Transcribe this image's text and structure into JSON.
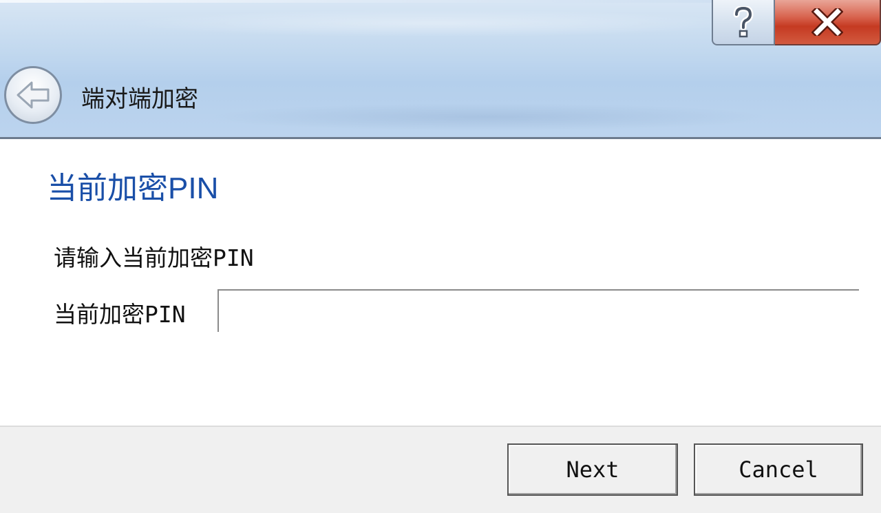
{
  "window": {
    "title": "端对端加密",
    "help_icon": "question-mark-icon",
    "close_icon": "close-x-icon",
    "back_icon": "back-arrow-icon"
  },
  "page": {
    "heading": "当前加密PIN",
    "instruction": "请输入当前加密PIN",
    "pin_label": "当前加密PIN",
    "pin_value": ""
  },
  "footer": {
    "next_label": "Next",
    "cancel_label": "Cancel"
  },
  "colors": {
    "heading": "#1a4fa8",
    "close_button": "#c53a22",
    "titlebar": "#b4cfec"
  }
}
